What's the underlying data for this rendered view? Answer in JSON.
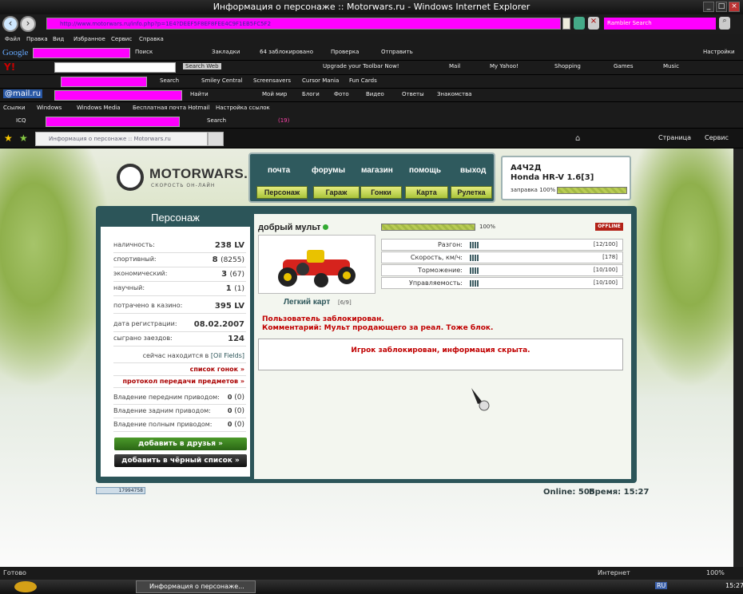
{
  "window": {
    "title": "Информация о персонаже :: Motorwars.ru - Windows Internet Explorer",
    "address": "http://www.motorwars.ru/info.php?p=1E4?DEEF5F8EF8FEE4C9F1EB5FC5F2",
    "search_placeholder": "Rambler Search"
  },
  "menu": [
    "Файл",
    "Правка",
    "Вид",
    "Избранное",
    "Сервис",
    "Справка"
  ],
  "toolbars": {
    "google": {
      "label": "Google",
      "search_btn": "Поиск",
      "bookmarks": "Закладки",
      "blocked": "64 заблокировано",
      "check": "Проверка",
      "send": "Отправить",
      "settings": "Настройки"
    },
    "yahoo": {
      "search_web": "Search Web",
      "upgrade": "Upgrade your Toolbar Now!",
      "mail": "Mail",
      "my_yahoo": "My Yahoo!",
      "shopping": "Shopping",
      "games": "Games",
      "music": "Music"
    },
    "myweb": {
      "search": "Search",
      "smiley": "Smiley Central",
      "screensavers": "Screensavers",
      "cursor": "Cursor Mania",
      "funcards": "Fun Cards"
    },
    "mailru": {
      "logo": "@mail.ru",
      "find": "Найти",
      "moy_mir": "Мой мир",
      "blogs": "Блоги",
      "photo": "Фото",
      "video": "Видео",
      "answers": "Ответы",
      "dating": "Знакомства"
    },
    "links": {
      "label": "Ссылки",
      "items": [
        "Windows",
        "Windows Media",
        "Бесплатная почта Hotmail",
        "Настройка ссылок"
      ]
    },
    "icq": {
      "label": "ICQ",
      "search": "Search",
      "count": "(19)"
    }
  },
  "tab": {
    "title": "Информация о персонаже :: Motorwars.ru"
  },
  "ie_cmds": {
    "page": "Страница",
    "tools": "Сервис"
  },
  "site": {
    "logo": "MOTORWARS.RU",
    "logo_sub": "СКОРОСТЬ ОН-ЛАЙН",
    "topnav": [
      "почта",
      "форумы",
      "магазин",
      "помощь",
      "выход"
    ],
    "subnav": [
      "Персонаж",
      "Гараж",
      "Гонки",
      "Карта",
      "Рулетка"
    ],
    "car": {
      "plate": "А4Ч2Д",
      "model": "Honda HR-V 1.6[3]",
      "fuel": "заправка 100%",
      "fuel_pct": 100
    }
  },
  "left": {
    "heading": "Персонаж",
    "rows": [
      {
        "label": "наличность:",
        "value": "238 LV"
      },
      {
        "label": "спортивный:",
        "value": "8",
        "extra": "(8255)"
      },
      {
        "label": "экономический:",
        "value": "3",
        "extra": "(67)"
      },
      {
        "label": "научный:",
        "value": "1",
        "extra": "(1)"
      },
      {
        "label": "потрачено в казино:",
        "value": "395 LV"
      },
      {
        "label": "дата регистрации:",
        "value": "08.02.2007"
      },
      {
        "label": "сыграно заездов:",
        "value": "124"
      }
    ],
    "location_prefix": "сейчас находится в",
    "location": "[Oil Fields]",
    "races_link": "список гонок »",
    "transfer_link": "протокол передачи предметов »",
    "drive_rows": [
      {
        "label": "Владение передним приводом:",
        "value": "0",
        "extra": "(0)"
      },
      {
        "label": "Владение задним приводом:",
        "value": "0",
        "extra": "(0)"
      },
      {
        "label": "Владение полным приводом:",
        "value": "0",
        "extra": "(0)"
      }
    ],
    "add_friends": "добавить в друзья »",
    "add_blacklist": "добавить в чёрный список »"
  },
  "right": {
    "name": "добрый мульт",
    "hp_pct_label": "100%",
    "hp_pct": 100,
    "status": "OFFLINE",
    "car_name": "Легкий карт",
    "car_level": "[6/9]",
    "stats": [
      {
        "label": "Разгон:",
        "value": "[12/100]"
      },
      {
        "label": "Скорость, км/ч:",
        "value": "[178]"
      },
      {
        "label": "Торможение:",
        "value": "[10/100]"
      },
      {
        "label": "Управляемость:",
        "value": "[10/100]"
      }
    ],
    "blocked_line1": "Пользователь заблокирован.",
    "blocked_line2": "Комментарий: Мульт продающего за реал. Тоже блок.",
    "hidden_msg": "Игрок заблокирован, информация скрыта."
  },
  "footer": {
    "counter": "17994758",
    "online": "Online: 505",
    "time_label": "Время: 15:27"
  },
  "statusbar": {
    "ready": "Готово",
    "zone": "Интернет",
    "zoom": "100%"
  },
  "taskbar": {
    "task": "Информация о персонаже...",
    "lang": "RU",
    "clock": "15:27"
  },
  "colors": {
    "accent": "#2c5559",
    "magenta": "#ff00ff",
    "blocked_red": "#c00000",
    "green_btn": "#a9c43a"
  }
}
